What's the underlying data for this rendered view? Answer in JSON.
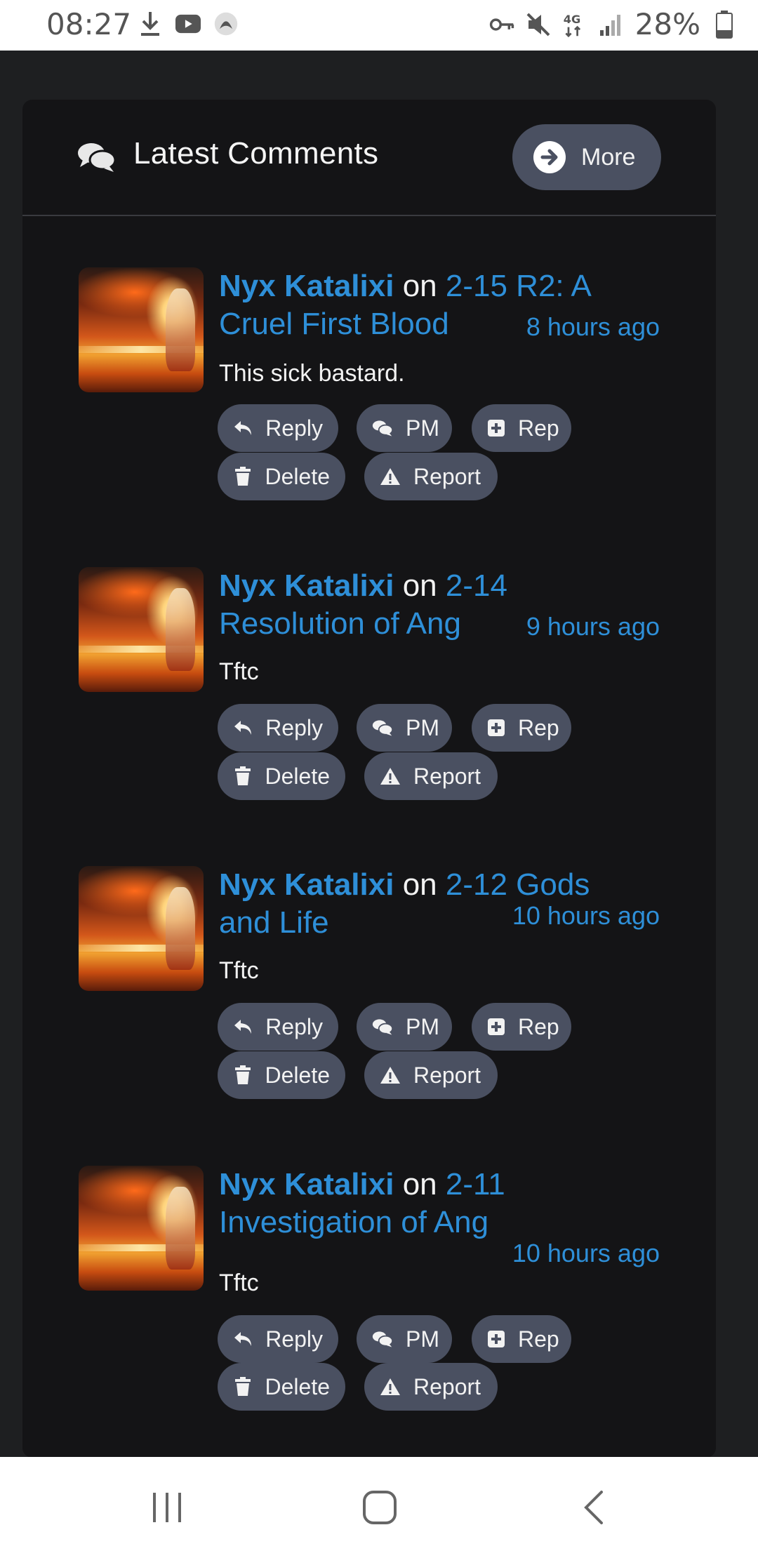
{
  "status": {
    "time": "08:27",
    "battery": "28%",
    "network": "4G"
  },
  "header": {
    "title": "Latest Comments",
    "more_label": "More"
  },
  "actions": {
    "reply": "Reply",
    "pm": "PM",
    "rep": "Rep",
    "delete": "Delete",
    "report": "Report"
  },
  "comments": [
    {
      "author": "Nyx Katalixi",
      "on": "on",
      "chapter_a": "2-15 R2: A",
      "chapter_b": "Cruel First Blood",
      "time": "8 hours ago",
      "text": "This sick bastard."
    },
    {
      "author": "Nyx Katalixi",
      "on": "on",
      "chapter_a": "2-14",
      "chapter_b": "Resolution of Ang",
      "time": "9 hours ago",
      "text": "Tftc"
    },
    {
      "author": "Nyx Katalixi",
      "on": "on",
      "chapter_a": "2-12 Gods",
      "chapter_b": "and Life",
      "time": "10 hours ago",
      "text": "Tftc"
    },
    {
      "author": "Nyx Katalixi",
      "on": "on",
      "chapter_a": "2-11",
      "chapter_b": "Investigation of Ang",
      "time": "10 hours ago",
      "text": "Tftc"
    }
  ],
  "colors": {
    "link": "#2e8fd8",
    "button": "#4a5061",
    "card": "#141416",
    "page": "#1e1f21"
  }
}
